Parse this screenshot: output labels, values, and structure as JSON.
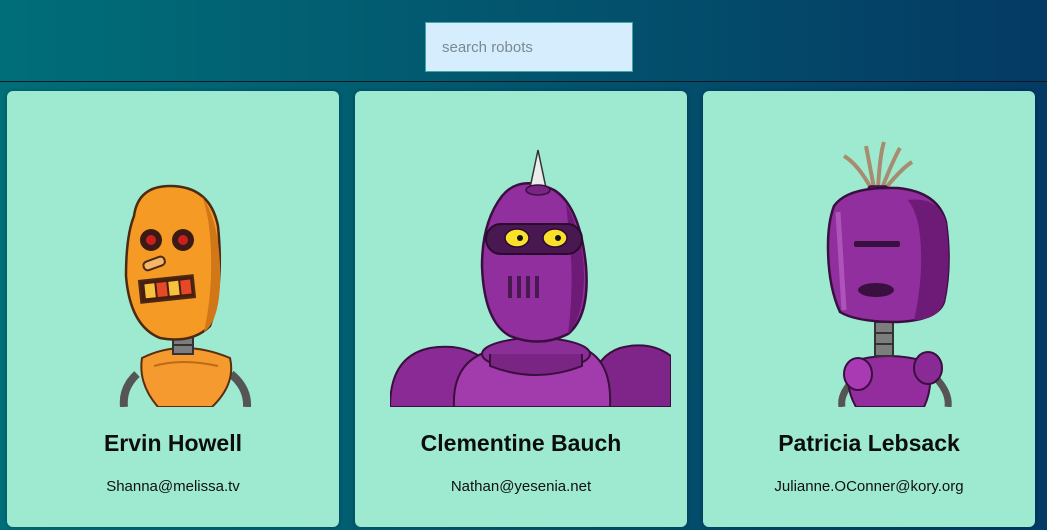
{
  "search": {
    "placeholder": "search robots",
    "value": ""
  },
  "robots": [
    {
      "name": "Ervin Howell",
      "email": "Shanna@melissa.tv",
      "color": "#f5972a",
      "avatar_icon": "orange-robot-icon"
    },
    {
      "name": "Clementine Bauch",
      "email": "Nathan@yesenia.net",
      "color": "#8f2a9b",
      "avatar_icon": "purple-robot-icon"
    },
    {
      "name": "Patricia Lebsack",
      "email": "Julianne.OConner@kory.org",
      "color": "#932c9d",
      "avatar_icon": "purple-robot-icon"
    }
  ],
  "colors": {
    "card_background": "#9eead0",
    "search_background": "#d6edfd",
    "header_gradient_start": "#006e78",
    "header_gradient_end": "#043a64"
  }
}
